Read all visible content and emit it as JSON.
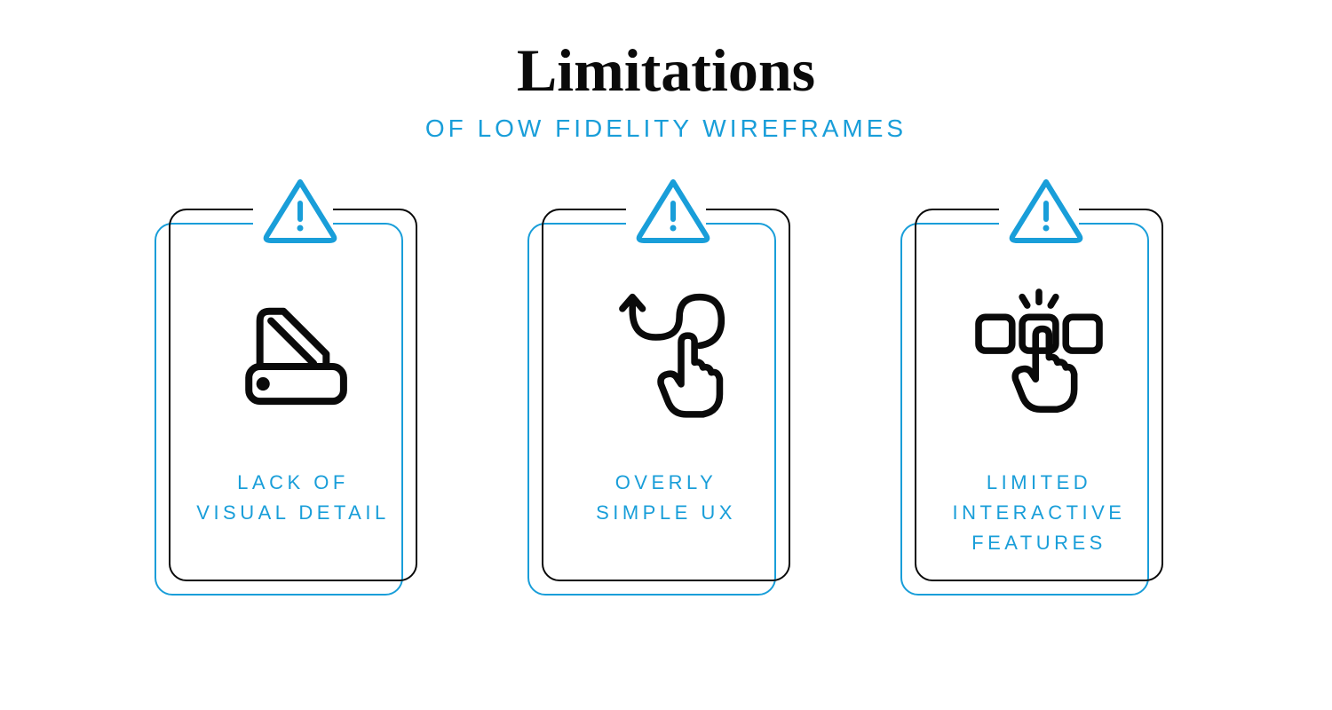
{
  "title": "Limitations",
  "subtitle": "OF LOW FIDELITY WIREFRAMES",
  "colors": {
    "accent": "#199ed9",
    "ink": "#0a0a0a"
  },
  "cards": [
    {
      "icon": "swatch-swiss-knife-icon",
      "caption": "LACK OF\nVISUAL DETAIL"
    },
    {
      "icon": "curvy-path-hand-icon",
      "caption": "OVERLY\nSIMPLE UX"
    },
    {
      "icon": "tap-select-boxes-icon",
      "caption": "LIMITED\nINTERACTIVE\nFEATURES"
    }
  ]
}
